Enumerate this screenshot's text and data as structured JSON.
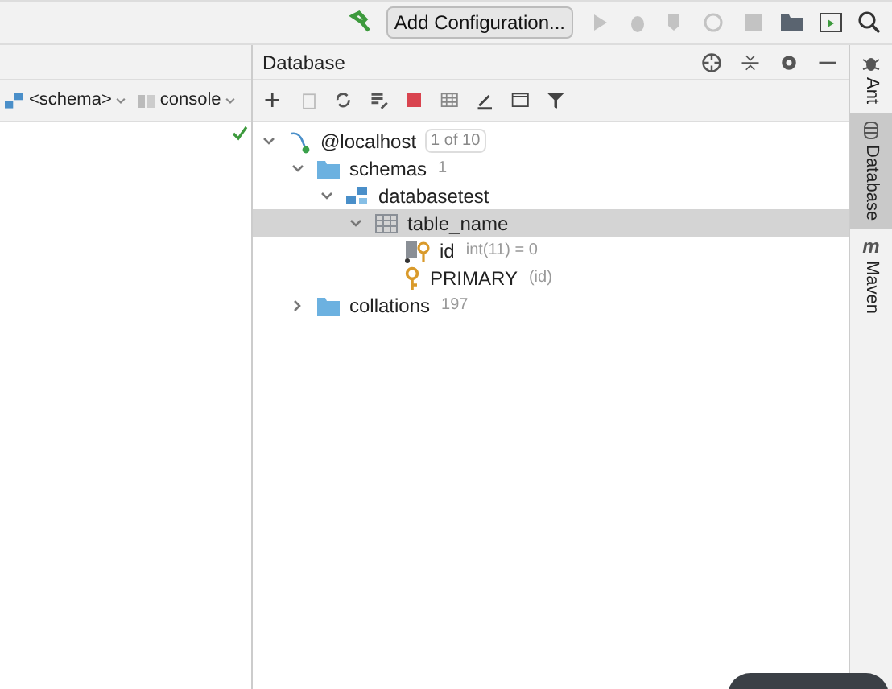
{
  "toolbar": {
    "run_config": "Add Configuration..."
  },
  "editor": {
    "schema": "<schema>",
    "console": "console"
  },
  "database_panel": {
    "title": "Database",
    "tree": [
      {
        "kind": "host",
        "label": "@localhost",
        "badge": "1 of 10",
        "expanded": true,
        "selected": false,
        "children": [
          {
            "kind": "folder",
            "label": "schemas",
            "detail": "1",
            "expanded": true,
            "selected": false,
            "children": [
              {
                "kind": "schema",
                "label": "databasetest",
                "expanded": true,
                "selected": false,
                "children": [
                  {
                    "kind": "table",
                    "label": "table_name",
                    "expanded": true,
                    "selected": true,
                    "children": [
                      {
                        "kind": "column",
                        "label": "id",
                        "detail": "int(11) = 0",
                        "selected": false
                      },
                      {
                        "kind": "key",
                        "label": "PRIMARY",
                        "detail": "(id)",
                        "selected": false
                      }
                    ]
                  }
                ]
              }
            ]
          },
          {
            "kind": "folder",
            "label": "collations",
            "detail": "197",
            "expanded": false,
            "selected": false
          }
        ]
      }
    ]
  },
  "side_tabs": [
    {
      "label": "Ant",
      "kind": "ant",
      "selected": false
    },
    {
      "label": "Database",
      "kind": "db",
      "selected": true
    },
    {
      "label": "Maven",
      "kind": "maven",
      "icon": "m",
      "selected": false
    }
  ]
}
